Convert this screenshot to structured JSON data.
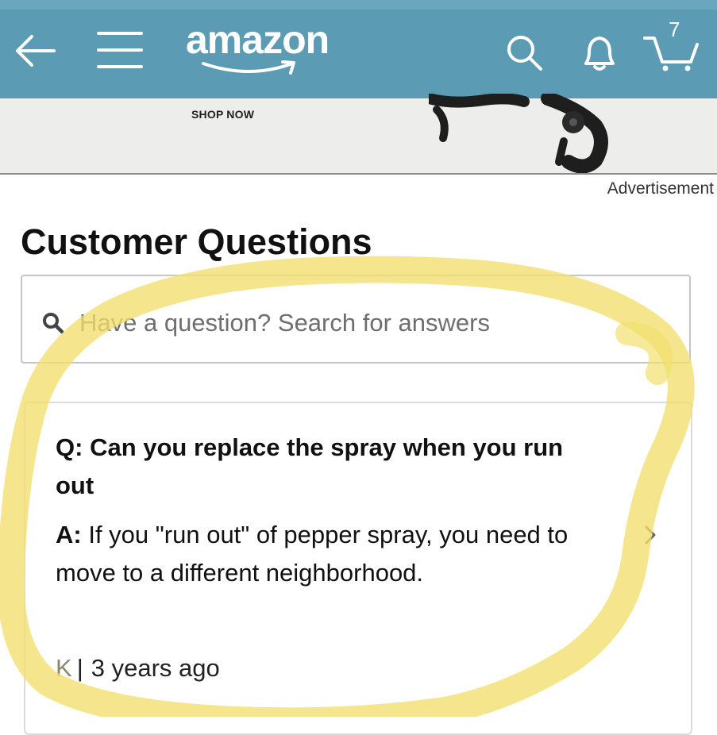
{
  "header": {
    "logo": "amazon",
    "cart_count": "7",
    "icons": [
      "back-arrow-icon",
      "hamburger-menu-icon",
      "search-icon",
      "notification-bell-icon",
      "cart-icon"
    ]
  },
  "ad": {
    "cta": "SHOP NOW",
    "label": "Advertisement"
  },
  "questions": {
    "title": "Customer Questions",
    "search_placeholder": "Have a question? Search for answers",
    "item": {
      "q_prefix": "Q:",
      "question": "Can you replace the spray when you run out",
      "a_prefix": "A:",
      "answer": "If you \"run out\" of pepper spray, you need to move to a different neighborhood.",
      "author": "K",
      "separator": "|",
      "time": "3 years ago"
    }
  },
  "colors": {
    "header": "#5b9bb4",
    "highlight": "#f2df6e"
  }
}
